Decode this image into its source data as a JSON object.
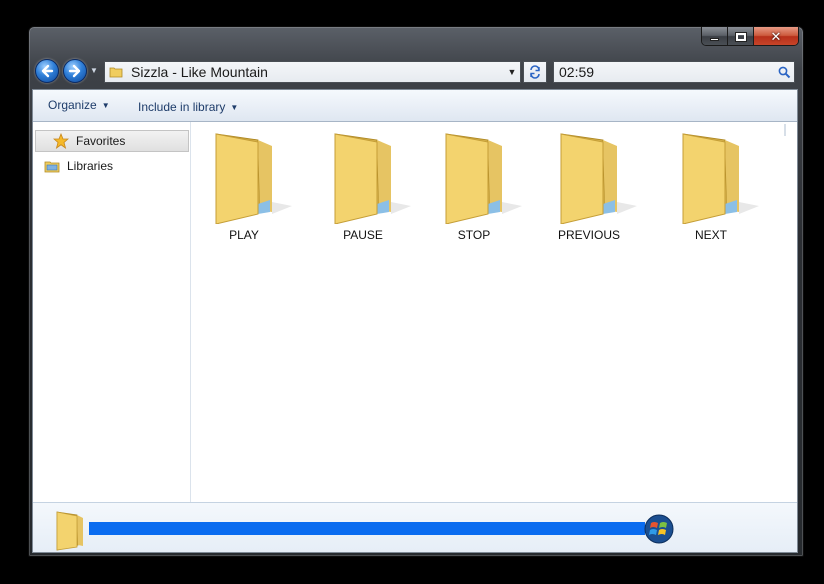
{
  "window": {
    "caption_buttons": {
      "minimize": "minimize",
      "maximize": "maximize",
      "close": "close"
    }
  },
  "address_bar": {
    "path": "Sizzla - Like Mountain"
  },
  "search_box": {
    "value": "02:59"
  },
  "toolbar": {
    "organize_label": "Organize",
    "include_label": "Include in library"
  },
  "nav_pane": {
    "items": [
      {
        "label": "Favorites",
        "icon": "star-icon",
        "selected": true
      },
      {
        "label": "Libraries",
        "icon": "libraries-icon",
        "selected": false
      }
    ]
  },
  "folders": [
    {
      "label": "PLAY"
    },
    {
      "label": "PAUSE"
    },
    {
      "label": "STOP"
    },
    {
      "label": "PREVIOUS"
    },
    {
      "label": "NEXT"
    }
  ],
  "details_pane": {
    "progress_percent": 100
  },
  "colors": {
    "folder_yellow": "#f3d36e",
    "progress_blue": "#0a6cf0",
    "toolbar_text": "#1e3c6a"
  }
}
